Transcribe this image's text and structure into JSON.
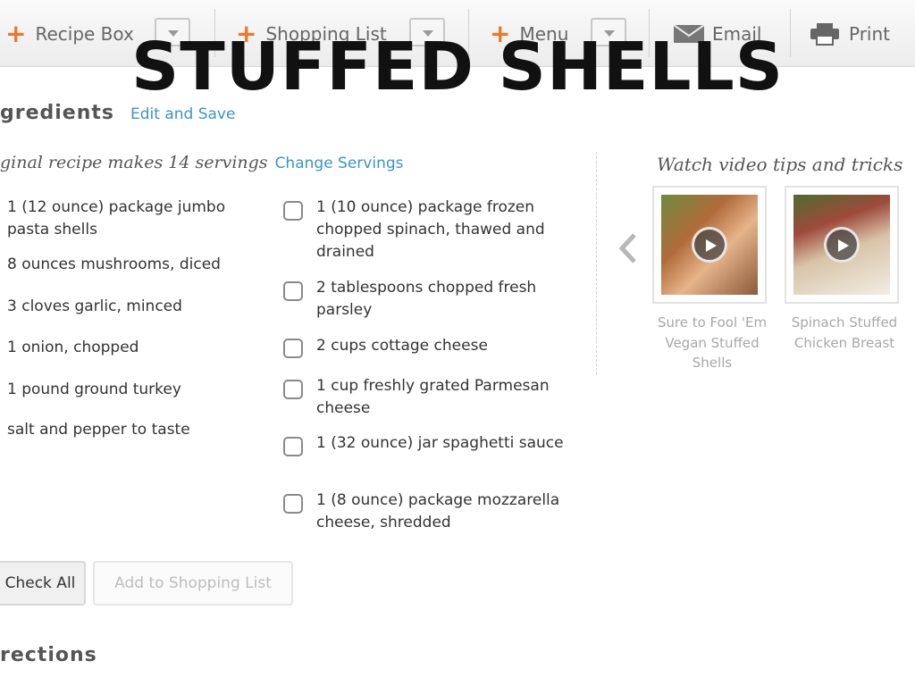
{
  "toolbar": {
    "recipe_box": "Recipe Box",
    "shopping_list": "Shopping List",
    "menu": "Menu",
    "email": "Email",
    "print": "Print"
  },
  "title": "STUFFED SHELLS",
  "ingredients": {
    "heading": "gredients",
    "edit_link": "Edit and Save",
    "servings_text": "ginal recipe makes 14 servings",
    "change_servings": "Change Servings",
    "column1": [
      "1 (12 ounce) package jumbo pasta shells",
      "8 ounces mushrooms, diced",
      "3 cloves garlic, minced",
      "1 onion, chopped",
      "1 pound ground turkey",
      "salt and pepper to taste"
    ],
    "column2": [
      "1 (10 ounce) package frozen chopped spinach, thawed and drained",
      "2 tablespoons chopped fresh parsley",
      "2 cups cottage cheese",
      "1 cup freshly grated Parmesan cheese",
      "1 (32 ounce) jar spaghetti sauce",
      "1 (8 ounce) package mozzarella cheese, shredded"
    ],
    "check_all": "Check All",
    "add_to_shopping_list": "Add to Shopping List"
  },
  "directions": {
    "heading": "rections"
  },
  "videos": {
    "heading": "Watch video tips and tricks",
    "items": [
      {
        "caption": "Sure to Fool 'Em Vegan Stuffed Shells"
      },
      {
        "caption": "Spinach Stuffed Chicken Breast"
      }
    ]
  },
  "colors": {
    "accent_orange": "#e8792b",
    "link_blue": "#3a95c8"
  }
}
